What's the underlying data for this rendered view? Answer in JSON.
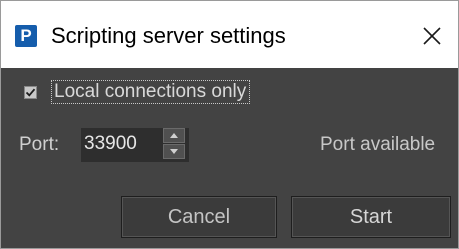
{
  "window": {
    "title": "Scripting server settings",
    "icon": "p-app-icon",
    "icon_letter": "P",
    "close_glyph": "close-icon"
  },
  "options": {
    "local_only_label": "Local connections only",
    "local_only_checked": true
  },
  "port": {
    "label": "Port:",
    "value": "33900",
    "status": "Port available"
  },
  "buttons": {
    "cancel": "Cancel",
    "start": "Start"
  },
  "colors": {
    "body_bg": "#434343",
    "field_bg": "#2e2e2e",
    "icon_blue": "#155dac"
  }
}
